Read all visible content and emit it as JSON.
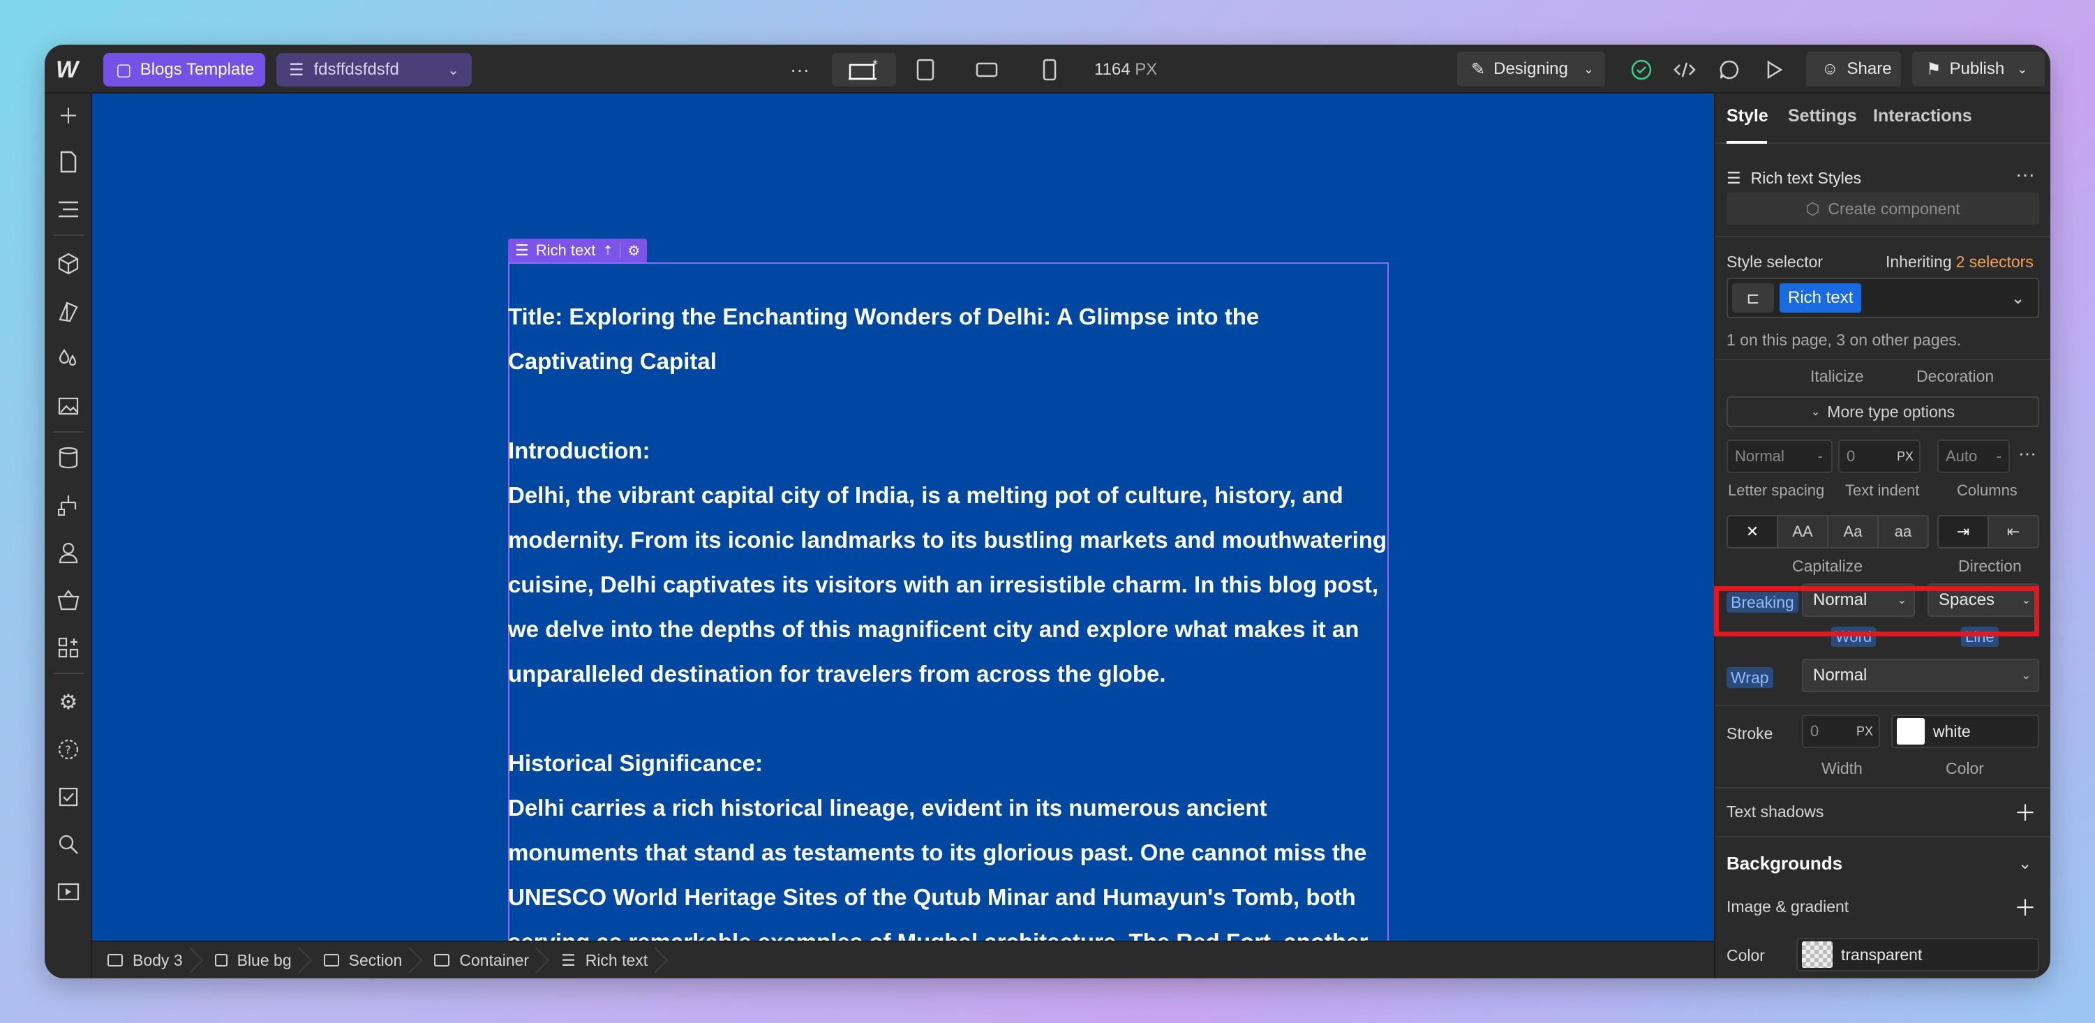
{
  "topbar": {
    "logo_icon": "webflow-logo-icon",
    "template_label": "Blogs Template",
    "database_label": "fdsffdsfdsfd",
    "more": "···",
    "width_value": "1164",
    "width_unit": "PX",
    "mode_label": "Designing",
    "share_label": "Share",
    "publish_label": "Publish"
  },
  "canvas": {
    "element_label": "Rich text",
    "content": {
      "title": "Title: Exploring the Enchanting Wonders of Delhi: A Glimpse into the Captivating Capital",
      "intro_heading": "Introduction:",
      "intro_body": "Delhi, the vibrant capital city of India, is a melting pot of culture, history, and modernity. From its iconic landmarks to its bustling markets and mouthwatering cuisine, Delhi captivates its visitors with an irresistible charm. In this blog post, we delve into the depths of this magnificent city and explore what makes it an unparalleled destination for travelers from across the globe.",
      "history_heading": "Historical Significance:",
      "history_body": "Delhi carries a rich historical lineage, evident in its numerous ancient monuments that stand as testaments to its glorious past. One cannot miss the UNESCO World Heritage Sites of the Qutub Minar and Humayun's Tomb, both serving as remarkable examples of Mughal architecture. The Red Fort, another iconic structure, showcases the splendor of the Mughal Empire with its massive walls and stunning palaces."
    }
  },
  "breadcrumb": [
    "Body 3",
    "Blue bg",
    "Section",
    "Container",
    "Rich text"
  ],
  "panel": {
    "tabs": [
      "Style",
      "Settings",
      "Interactions"
    ],
    "styles_title": "Rich text Styles",
    "create_component": "Create component",
    "style_selector_label": "Style selector",
    "inheriting_prefix": "Inheriting",
    "inheriting_count": "2 selectors",
    "selector_chip": "Rich text",
    "selector_note": "1 on this page, 3 on other pages.",
    "italicize_label": "Italicize",
    "decoration_label": "Decoration",
    "more_type_options": "More type options",
    "letter_spacing_value": "Normal",
    "letter_spacing_dash": "-",
    "text_indent_value": "0",
    "text_indent_unit": "PX",
    "columns_value": "Auto",
    "columns_dash": "-",
    "letter_spacing_label": "Letter spacing",
    "text_indent_label": "Text indent",
    "columns_label": "Columns",
    "capitalize_options": [
      "✕",
      "AA",
      "Aa",
      "aa"
    ],
    "capitalize_label": "Capitalize",
    "direction_label": "Direction",
    "breaking_label": "Breaking",
    "word_break_value": "Normal",
    "line_break_value": "Spaces",
    "word_label": "Word",
    "line_label": "Line",
    "wrap_label": "Wrap",
    "wrap_value": "Normal",
    "stroke_label": "Stroke",
    "stroke_width_value": "0",
    "stroke_width_unit": "PX",
    "stroke_color_value": "white",
    "width_label": "Width",
    "color_label": "Color",
    "text_shadows_label": "Text shadows",
    "backgrounds_label": "Backgrounds",
    "image_gradient_label": "Image & gradient",
    "bg_color_label": "Color",
    "bg_color_value": "transparent"
  },
  "colors": {
    "accent": "#7552e6",
    "canvas_bg": "#0047a1",
    "highlight": "#e5161e",
    "selector_chip": "#1a6be0",
    "inheriting": "#f5a35a"
  }
}
